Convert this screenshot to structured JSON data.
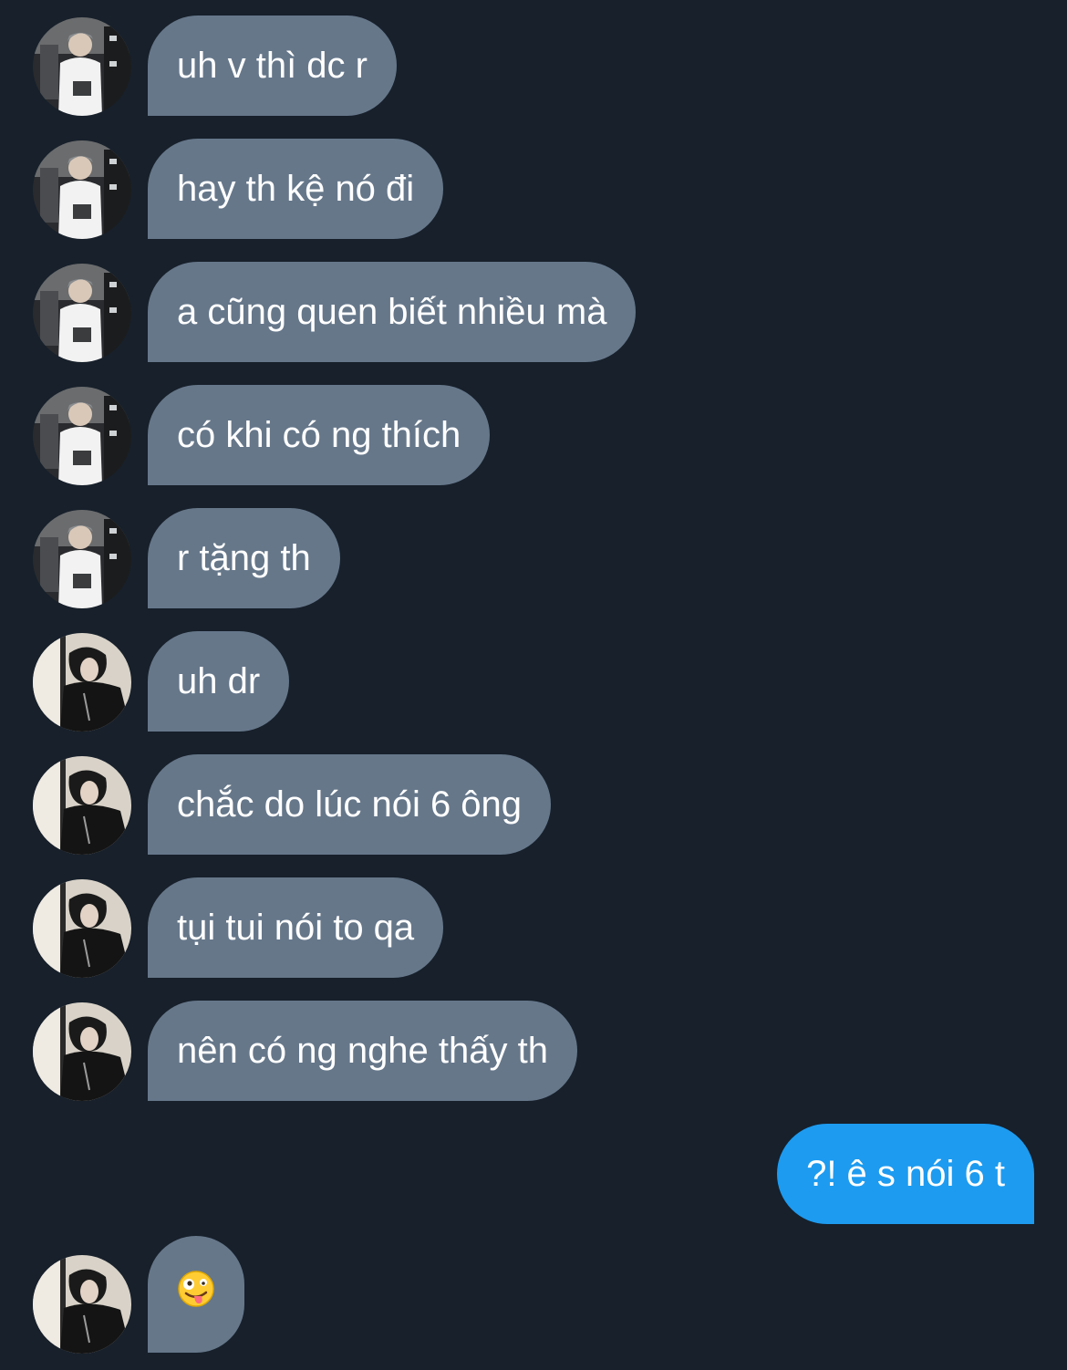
{
  "conversation": {
    "messages": [
      {
        "sender": "them",
        "avatar": "avatar-a",
        "text": "uh v thì dc r"
      },
      {
        "sender": "them",
        "avatar": "avatar-a",
        "text": "hay th kệ nó đi"
      },
      {
        "sender": "them",
        "avatar": "avatar-a",
        "text": "a cũng quen biết nhiều mà"
      },
      {
        "sender": "them",
        "avatar": "avatar-a",
        "text": "có khi có ng thích"
      },
      {
        "sender": "them",
        "avatar": "avatar-a",
        "text": "r tặng th"
      },
      {
        "sender": "them",
        "avatar": "avatar-b",
        "text": "uh dr"
      },
      {
        "sender": "them",
        "avatar": "avatar-b",
        "text": "chắc do lúc nói 6 ông"
      },
      {
        "sender": "them",
        "avatar": "avatar-b",
        "text": "tụi tui nói to qa"
      },
      {
        "sender": "them",
        "avatar": "avatar-b",
        "text": "nên có ng nghe thấy th"
      },
      {
        "sender": "me",
        "text": "?! ê s nói 6 t"
      },
      {
        "sender": "them",
        "avatar": "avatar-b",
        "emoji": "zany-face-icon"
      }
    ]
  },
  "colors": {
    "background": "#17202b",
    "incoming_bubble": "#66778a",
    "outgoing_bubble": "#1d9bf0",
    "text": "#ffffff"
  }
}
